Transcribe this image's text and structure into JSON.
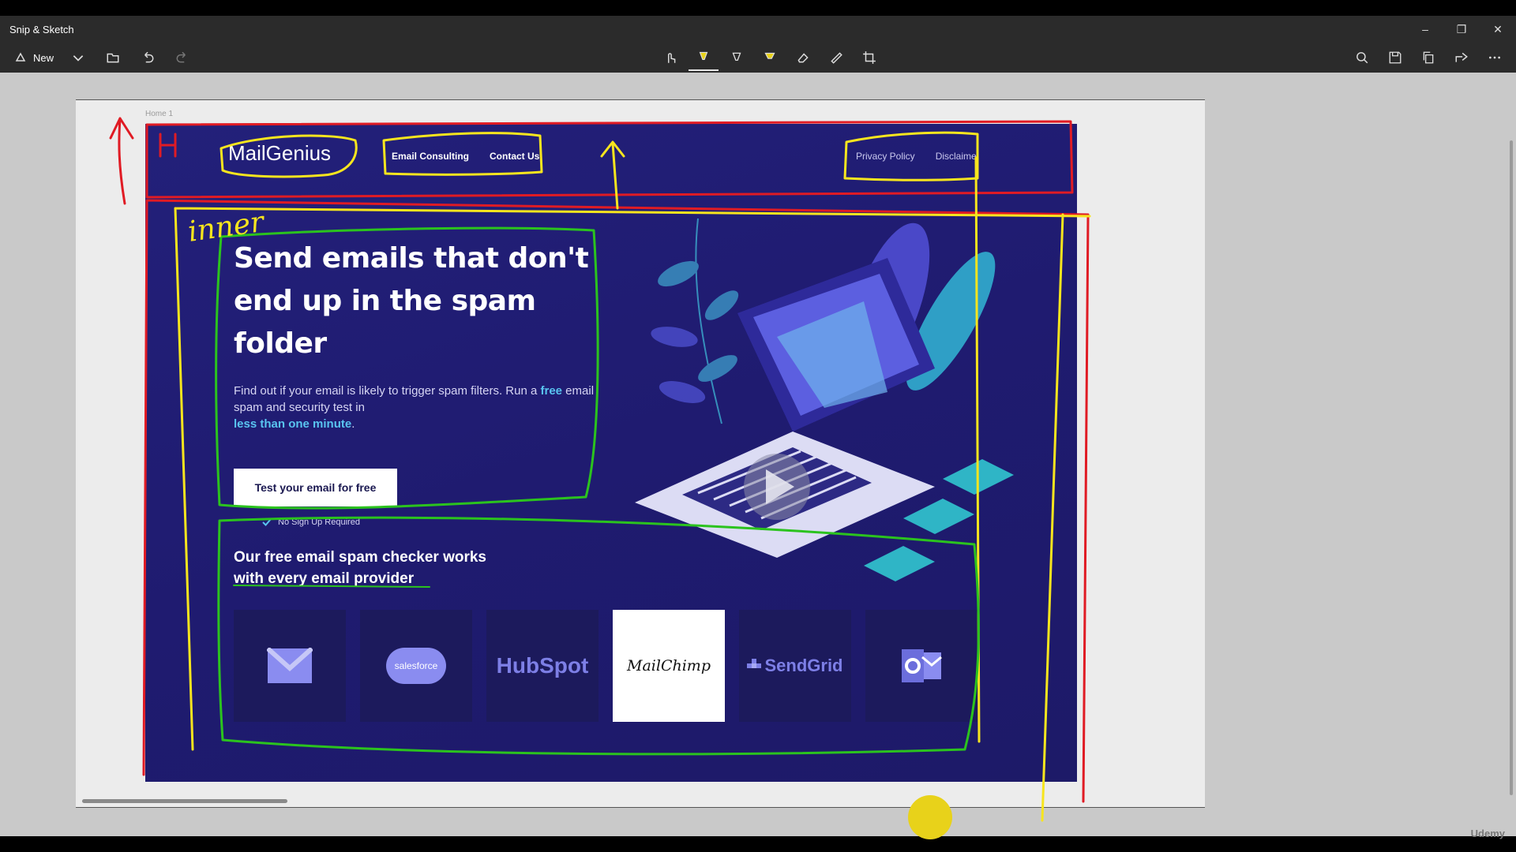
{
  "app": {
    "title": "Snip & Sketch"
  },
  "toolbar": {
    "new_label": "New"
  },
  "document": {
    "tab_label": "Home 1"
  },
  "site": {
    "logo_text": "MailGenius",
    "nav_left": [
      "Email Consulting",
      "Contact Us"
    ],
    "nav_right": [
      "Privacy Policy",
      "Disclaime"
    ],
    "hero": {
      "headline_line1": "Send emails that don't",
      "headline_line2": "end up in the spam folder",
      "desc_part1": "Find out if your email is likely to trigger spam filters. Run a ",
      "desc_free": "free",
      "desc_part2": " email spam and security test in ",
      "desc_fast": "less than one minute",
      "desc_end": ".",
      "cta": "Test your email for free",
      "no_signup": "No Sign Up Required"
    },
    "providers_title": "Our free email spam checker works with every email provider",
    "providers": [
      {
        "label": "",
        "icon": "gmail-icon"
      },
      {
        "label": "salesforce",
        "icon": "salesforce-icon"
      },
      {
        "label": "HubSpot",
        "icon": "hubspot-icon"
      },
      {
        "label": "MailChimp",
        "icon": "mailchimp-icon"
      },
      {
        "label": "SendGrid",
        "icon": "sendgrid-icon"
      },
      {
        "label": "",
        "icon": "outlook-icon"
      }
    ]
  },
  "annotations": {
    "header_label": "H",
    "inner_label": "inner"
  },
  "footer": {
    "watermark": "Udemy"
  },
  "colors": {
    "page_bg": "#23207a",
    "accent": "#59c4f0",
    "window_chrome": "#2b2b2b"
  }
}
